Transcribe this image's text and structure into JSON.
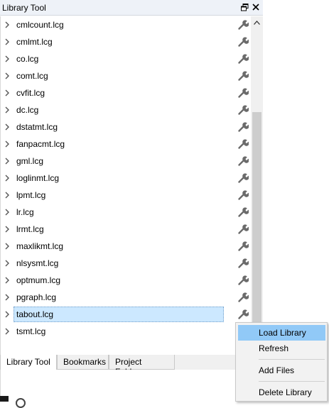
{
  "window": {
    "title": "Library Tool"
  },
  "files": [
    {
      "name": "cmlcount.lcg"
    },
    {
      "name": "cmlmt.lcg"
    },
    {
      "name": "co.lcg"
    },
    {
      "name": "comt.lcg"
    },
    {
      "name": "cvfit.lcg"
    },
    {
      "name": "dc.lcg"
    },
    {
      "name": "dstatmt.lcg"
    },
    {
      "name": "fanpacmt.lcg"
    },
    {
      "name": "gml.lcg"
    },
    {
      "name": "loglinmt.lcg"
    },
    {
      "name": "lpmt.lcg"
    },
    {
      "name": "lr.lcg"
    },
    {
      "name": "lrmt.lcg"
    },
    {
      "name": "maxlikmt.lcg"
    },
    {
      "name": "nlsysmt.lcg"
    },
    {
      "name": "optmum.lcg"
    },
    {
      "name": "pgraph.lcg"
    },
    {
      "name": "tabout.lcg",
      "selected": true
    },
    {
      "name": "tsmt.lcg"
    }
  ],
  "tabs": [
    {
      "label": "Library Tool",
      "active": true
    },
    {
      "label": "Bookmarks"
    },
    {
      "label": "Project Folders"
    }
  ],
  "context_menu": {
    "items": [
      "Load Library",
      "Refresh",
      "Add Files",
      "Delete Library"
    ],
    "hovered": "Load Library"
  },
  "colors": {
    "selection": "#cce8ff",
    "menu_hover": "#91c9f7",
    "titlebar": "#eef2f8"
  },
  "icons": {
    "row_expander": "chevron-right-icon",
    "row_action": "wrench-icon",
    "float": "restore-window-icon",
    "close": "close-icon"
  }
}
